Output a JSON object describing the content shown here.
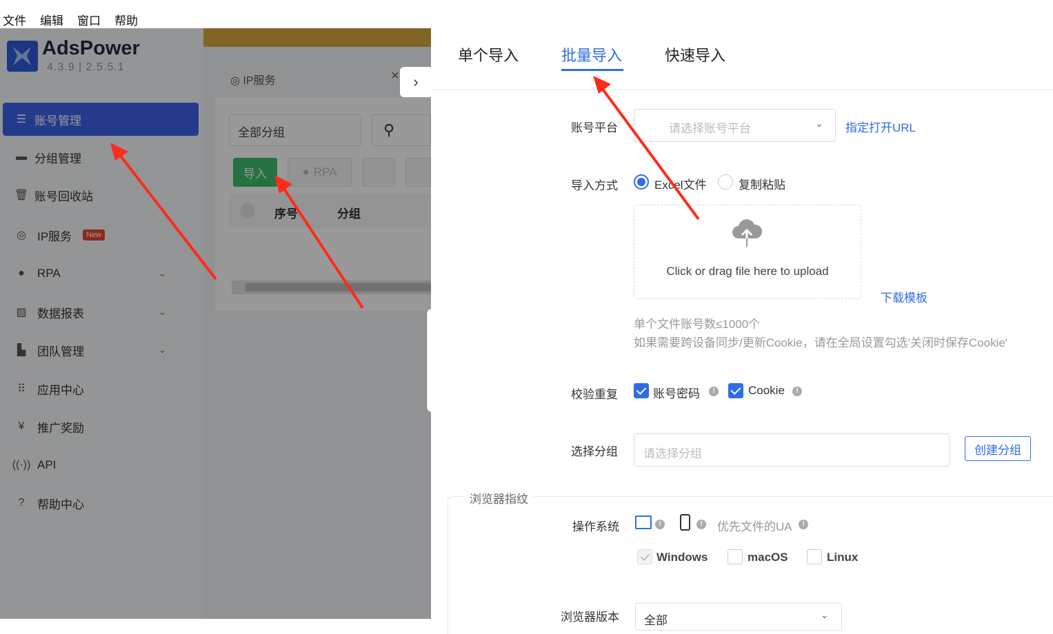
{
  "menubar": {
    "file": "文件",
    "edit": "编辑",
    "window": "窗口",
    "help": "帮助"
  },
  "app": {
    "brand": "AdsPower",
    "version": "4.3.9 | 2.5.5.1",
    "accent": "#3c63e8",
    "nav": [
      {
        "label": "账号管理",
        "icon": "list-icon",
        "active": true
      },
      {
        "label": "分组管理",
        "icon": "group-icon"
      },
      {
        "label": "账号回收站",
        "icon": "trash-icon"
      },
      {
        "label": "IP服务",
        "icon": "ip-icon",
        "badge": "New"
      },
      {
        "label": "RPA",
        "icon": "robot-icon",
        "expandable": true
      },
      {
        "label": "数据报表",
        "icon": "chart-icon",
        "expandable": true
      },
      {
        "label": "团队管理",
        "icon": "team-icon",
        "expandable": true
      },
      {
        "label": "应用中心",
        "icon": "grid-icon"
      },
      {
        "label": "推广奖励",
        "icon": "reward-icon"
      },
      {
        "label": "API",
        "icon": "api-icon"
      },
      {
        "label": "帮助中心",
        "icon": "help-icon"
      }
    ],
    "ip_tab": "IP服务",
    "group_filter": "全部分组",
    "import_button": "导入",
    "rpa_button": "RPA",
    "table": {
      "col_seq": "序号",
      "col_group": "分组"
    }
  },
  "drawer": {
    "tabs": [
      "单个导入",
      "批量导入",
      "快速导入"
    ],
    "active_tab": "批量导入",
    "platform_label": "账号平台",
    "platform_placeholder": "请选择账号平台",
    "open_url_link": "指定打开URL",
    "import_method_label": "导入方式",
    "method_excel": "Excel文件",
    "method_paste": "复制粘贴",
    "upload_text": "Click or drag file here to upload",
    "download_template": "下载模板",
    "hint1": "单个文件账号数≤1000个",
    "hint2": "如果需要跨设备同步/更新Cookie，请在全局设置勾选'关闭时保存Cookie'",
    "verify_label": "校验重复",
    "verify_password": "账号密码",
    "verify_cookie": "Cookie",
    "group_label": "选择分组",
    "group_placeholder": "请选择分组",
    "create_group_button": "创建分组",
    "fingerprint_section": "浏览器指纹",
    "os_label": "操作系统",
    "os_pref": "优先文件的UA",
    "os_windows": "Windows",
    "os_macos": "macOS",
    "os_linux": "Linux",
    "browser_version_label": "浏览器版本",
    "browser_version_value": "全部"
  }
}
